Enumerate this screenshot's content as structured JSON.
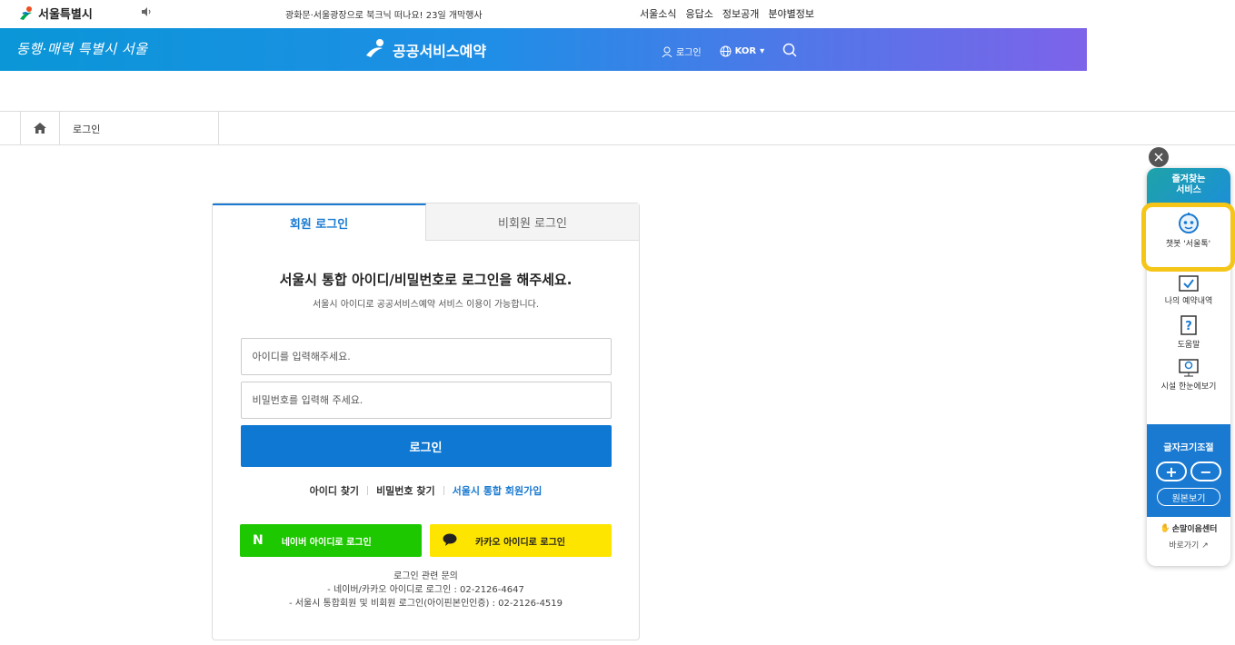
{
  "topbar": {
    "logo_text": "서울특별시",
    "ticker": "광화문·서울광장으로 북크닉 떠나요! 23일 개막행사",
    "links": [
      "서울소식",
      "응답소",
      "정보공개",
      "분야별정보"
    ]
  },
  "header": {
    "slogan": "동행·매력 특별시 서울",
    "brand": "공공서비스예약",
    "login": "로그인",
    "language": "KOR"
  },
  "breadcrumb": {
    "current": "로그인"
  },
  "login": {
    "tabs": [
      "회원 로그인",
      "비회원 로그인"
    ],
    "headline": "서울시 통합 아이디/비밀번호로 로그인을 해주세요.",
    "subline": "서울시 아이디로 공공서비스예약 서비스 이용이 가능합니다.",
    "id_placeholder": "아이디를 입력해주세요.",
    "pw_placeholder": "비밀번호를 입력해 주세요.",
    "login_button": "로그인",
    "find_id": "아이디 찾기",
    "find_pw": "비밀번호 찾기",
    "join": "서울시 통합 회원가입",
    "naver": "네이버 아이디로 로그인",
    "kakao": "카카오 아이디로 로그인",
    "info_title": "로그인 관련 문의",
    "info_line1": "- 네이버/카카오 아이디로 로그인 : 02-2126-4647",
    "info_line2": "- 서울시 통합회원 및 비회원 로그인(아이핀본인인증) : 02-2126-4519"
  },
  "quick": {
    "title_line1": "즐겨찾는",
    "title_line2": "서비스",
    "chatbot": "챗봇 '서울톡'",
    "my_reservation": "나의 예약내역",
    "help": "도움말",
    "facility": "시설 한눈에보기",
    "font_title": "글자크기조절",
    "plus": "+",
    "minus": "−",
    "original": "원본보기",
    "sign_center": "손말이음센터",
    "shortcut": "바로가기"
  },
  "colors": {
    "accent": "#0f78d2",
    "naver": "#1ec800",
    "kakao": "#fee500",
    "highlight": "#f5c518"
  }
}
